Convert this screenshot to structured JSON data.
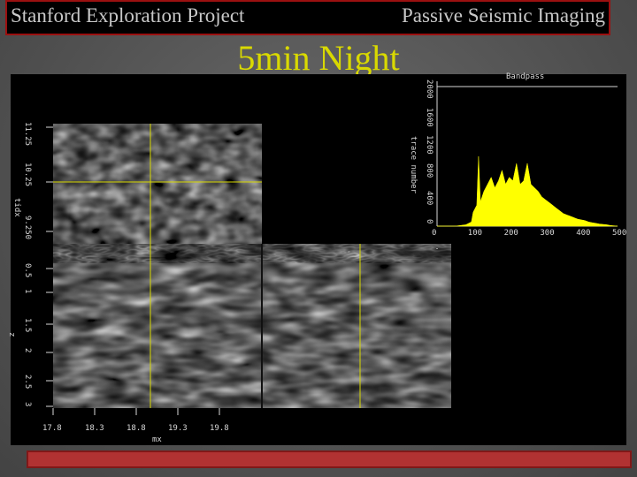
{
  "header": {
    "left": "Stanford Exploration Project",
    "right": "Passive Seismic Imaging"
  },
  "slide": {
    "title": "5min Night"
  },
  "viewer": {
    "top_axis_label": "tidx",
    "top_axis_ticks": [
      "11.25",
      "10.25",
      "9.250"
    ],
    "depth_axis_label": "z",
    "depth_axis_ticks": [
      "0.5",
      "1",
      "1.5",
      "2",
      "2.5",
      "3"
    ],
    "x_axis_label": "mx",
    "x_axis_ticks": [
      "17.8",
      "18.3",
      "18.8",
      "19.3",
      "19.8"
    ]
  },
  "spectrum": {
    "title": "Bandpass",
    "ylabel": "trace number",
    "y_ticks": [
      "0",
      "400",
      "800",
      "1200",
      "1600",
      "2000"
    ],
    "x_ticks": [
      "0",
      "100",
      "200",
      "300",
      "400",
      "500"
    ],
    "color": "#ffff00"
  },
  "chart_data": {
    "type": "area",
    "title": "Bandpass",
    "ylabel": "trace number",
    "xlim": [
      0,
      500
    ],
    "ylim": [
      0,
      2000
    ],
    "x": [
      0,
      50,
      80,
      95,
      100,
      110,
      115,
      120,
      130,
      140,
      150,
      160,
      170,
      180,
      190,
      200,
      210,
      220,
      230,
      240,
      250,
      260,
      270,
      280,
      290,
      300,
      310,
      320,
      330,
      340,
      350,
      360,
      370,
      380,
      390,
      400,
      410,
      420,
      430,
      440,
      450,
      460,
      470,
      480,
      490,
      500
    ],
    "values": [
      0,
      0,
      20,
      60,
      200,
      300,
      1000,
      350,
      500,
      600,
      700,
      550,
      650,
      800,
      600,
      700,
      650,
      900,
      600,
      650,
      900,
      600,
      550,
      500,
      420,
      380,
      340,
      300,
      260,
      220,
      180,
      160,
      140,
      120,
      100,
      90,
      80,
      60,
      50,
      40,
      30,
      25,
      20,
      10,
      5,
      0
    ]
  }
}
